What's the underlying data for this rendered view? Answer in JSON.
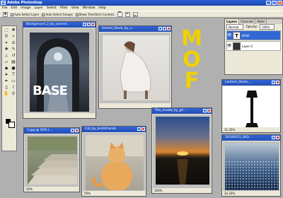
{
  "app": {
    "title": "Adobe Photoshop",
    "icon_label": "Ps",
    "window_buttons": [
      "_",
      "□",
      "×"
    ]
  },
  "menu": [
    "File",
    "Edit",
    "Image",
    "Layer",
    "Select",
    "Filter",
    "View",
    "Window",
    "Help"
  ],
  "options_bar": {
    "auto_select_layer": "Auto Select Layer",
    "auto_select_groups": "Auto Select Groups",
    "show_transform": "Show Transform Controls"
  },
  "overlay_text": {
    "mof": [
      "M",
      "O",
      "F"
    ]
  },
  "documents": [
    {
      "title": "Background_2_by_sacred...",
      "status": "",
      "label": "BASE"
    },
    {
      "title": "Sorted_Stock_by_s...",
      "status": ""
    },
    {
      "title": "1.jpg @ 50% (...",
      "status": "50%"
    },
    {
      "title": "Cat_by_birdsfriends",
      "status": "50%"
    },
    {
      "title": "The_model_by_gh...",
      "status": "100%"
    },
    {
      "title": "Lantern_Stock_...",
      "status": "11.25%"
    },
    {
      "title": "20100115_S63...",
      "status": "33.33%"
    }
  ],
  "layers_panel": {
    "tabs": [
      "Layers",
      "Channels",
      "Paths"
    ],
    "blend_mode": "Normal",
    "opacity_label": "Opacity:",
    "opacity": "100%",
    "rows": [
      {
        "name": "BASE",
        "thumb": "T"
      },
      {
        "name": "Layer 0",
        "thumb": ""
      }
    ]
  },
  "colors": {
    "titlebar": "#2a5fd6",
    "mof": "#f0d000",
    "layer_active": "#3168d4"
  }
}
